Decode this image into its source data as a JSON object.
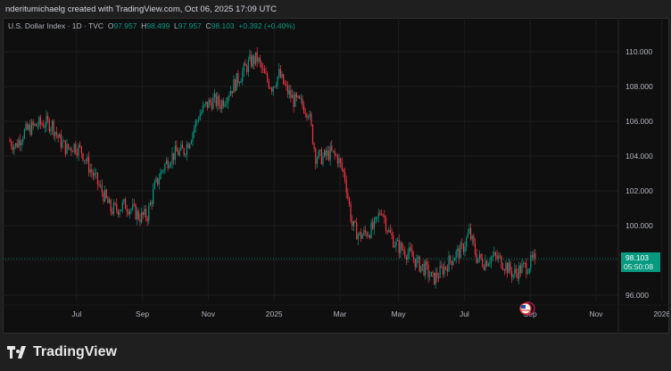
{
  "header": {
    "attribution": "nderitumichaelg created with TradingView.com, Oct 06, 2025 17:09 UTC"
  },
  "legend": {
    "symbol": "U.S. Dollar Index · 1D · TVC",
    "open_label": "O",
    "open": "97.957",
    "high_label": "H",
    "high": "98.499",
    "low_label": "L",
    "low": "97.957",
    "close_label": "C",
    "close": "98.103",
    "change": "+0.392 (+0.40%)"
  },
  "price_tag": {
    "price": "98.103",
    "countdown": "05:50:08"
  },
  "footer": {
    "brand": "TradingView"
  },
  "colors": {
    "up": "#089981",
    "down": "#f23645",
    "background": "#0f0f0f",
    "grid": "#1c1c1c"
  },
  "chart_data": {
    "type": "candlestick",
    "title": "U.S. Dollar Index · 1D · TVC",
    "ylim": [
      94.9,
      111.2
    ],
    "y_ticks": [
      "96.000",
      "98.000",
      "100.000",
      "102.000",
      "104.000",
      "106.000",
      "108.000",
      "110.000"
    ],
    "y_tick_values": [
      96,
      98,
      100,
      102,
      104,
      106,
      108,
      110
    ],
    "x_ticks": [
      "Jul",
      "Sep",
      "Nov",
      "2025",
      "Mar",
      "May",
      "Jul",
      "Sep",
      "Nov",
      "2026"
    ],
    "x_tick_week_index": [
      4,
      13,
      22,
      31,
      40,
      48,
      57,
      66,
      75,
      84
    ],
    "weekly_closes_approx": [
      104.9,
      104.6,
      105.3,
      105.6,
      105.8,
      105.9,
      105.8,
      104.9,
      104.4,
      104.6,
      104.3,
      103.4,
      102.6,
      101.8,
      100.9,
      101.0,
      101.2,
      100.9,
      100.5,
      100.6,
      102.2,
      103.2,
      103.9,
      104.2,
      104.3,
      105.2,
      106.3,
      106.9,
      107.2,
      107.0,
      107.6,
      108.2,
      108.8,
      109.4,
      109.6,
      108.6,
      108.0,
      108.7,
      107.8,
      107.2,
      107.0,
      106.6,
      104.0,
      103.9,
      104.2,
      103.9,
      102.8,
      100.0,
      99.4,
      99.6,
      99.9,
      101.0,
      99.6,
      98.9,
      98.6,
      98.3,
      97.8,
      97.5,
      96.9,
      97.3,
      97.8,
      98.3,
      98.6,
      99.6,
      98.2,
      97.9,
      98.2,
      98.1,
      97.7,
      97.2,
      97.5,
      97.7,
      98.103
    ],
    "last_price": 98.103,
    "total_weeks_span": 87
  }
}
